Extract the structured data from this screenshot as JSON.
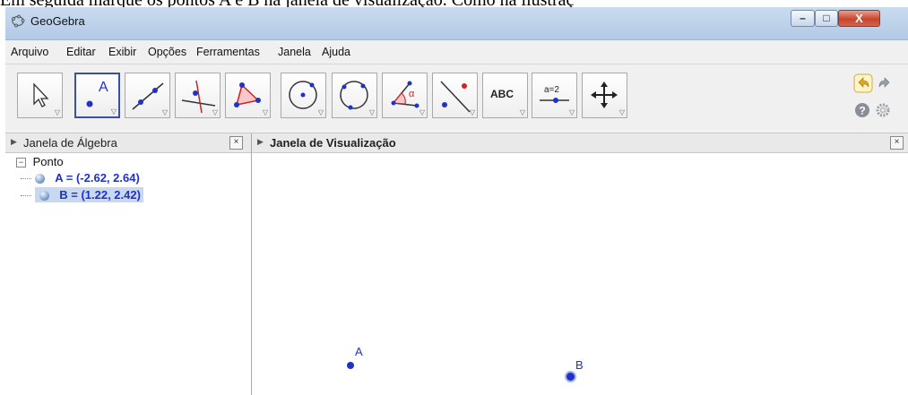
{
  "caption": "Em seguida marque os pontos A e B na janela de visualização. Como na ilustraç",
  "window": {
    "title": "GeoGebra",
    "min_label": "–",
    "max_label": "□",
    "close_label": "X"
  },
  "menu": [
    "Arquivo",
    "Editar",
    "Exibir",
    "Opções",
    "Ferramentas",
    "Janela",
    "Ajuda"
  ],
  "toolbar": {
    "tools": [
      {
        "name": "move-tool",
        "icon": "cursor-arrow"
      },
      {
        "name": "point-tool",
        "icon": "point-A",
        "text": "A"
      },
      {
        "name": "line-tool",
        "icon": "line-through-points"
      },
      {
        "name": "perpendicular-tool",
        "icon": "perpendicular-lines"
      },
      {
        "name": "polygon-tool",
        "icon": "triangle"
      },
      {
        "name": "circle-tool",
        "icon": "circle-center-point"
      },
      {
        "name": "conic-tool",
        "icon": "circle-three-points"
      },
      {
        "name": "angle-tool",
        "icon": "angle-alpha",
        "text": "α"
      },
      {
        "name": "reflect-tool",
        "icon": "reflect-point-line"
      },
      {
        "name": "text-tool",
        "icon": "text-abc",
        "text": "ABC"
      },
      {
        "name": "slider-tool",
        "icon": "slider",
        "text": "a=2"
      },
      {
        "name": "move-graphics-tool",
        "icon": "move-cross"
      }
    ],
    "selected_index": 1
  },
  "algebra": {
    "title": "Janela de Álgebra",
    "group": "Ponto",
    "items": [
      {
        "label": "A = (-2.62, 2.64)",
        "selected": false
      },
      {
        "label": "B = (1.22, 2.42)",
        "selected": true
      }
    ]
  },
  "graphics": {
    "title": "Janela de Visualização",
    "points": [
      {
        "name": "A",
        "selected": false
      },
      {
        "name": "B",
        "selected": true
      }
    ]
  },
  "colors": {
    "point": "#1f31c7",
    "selection": "#c8d8f0"
  }
}
